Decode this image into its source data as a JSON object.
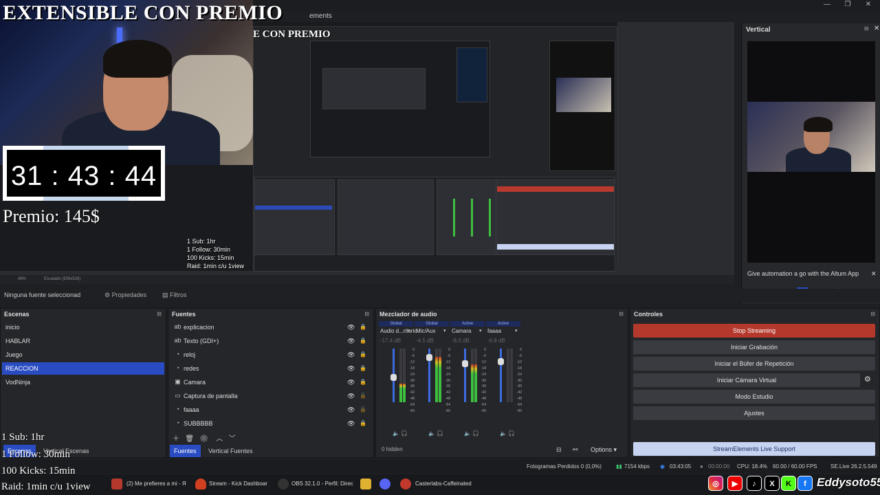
{
  "window": {
    "menu_fragment": "ements",
    "minimize": "—",
    "restore": "❐",
    "close": "✕"
  },
  "overlay": {
    "title": "EXTENSIBLE CON PREMIO",
    "title_nested": "E CON PREMIO",
    "timer": "31 : 43 : 44",
    "premio": "Premio: 145$",
    "rules": [
      "1 Sub: 1hr",
      "1 Follow: 30min",
      "100 Kicks: 15min",
      "Raid: 1min c/u 1view"
    ],
    "handle": "Eddysoto55"
  },
  "preview": {
    "zoom": "48%",
    "scale": "Escalado (939x528)"
  },
  "vertical": {
    "title": "Vertical",
    "altum_text": "Give automation a go with the Altum App"
  },
  "source_toolbar": {
    "no_source": "Ninguna fuente seleccionad",
    "properties": "Propiedades",
    "filters": "Filtros"
  },
  "scenes": {
    "title": "Escenas",
    "items": [
      "inicio",
      "HABLAR",
      "Juego",
      "REACCION",
      "VodNinja"
    ],
    "selected": "REACCION",
    "tabs": [
      "Escenas",
      "Vertical Escenas"
    ]
  },
  "sources": {
    "title": "Fuentes",
    "items": [
      {
        "icon": "ab",
        "label": "explicacion"
      },
      {
        "icon": "ab",
        "label": "Texto (GDI+)"
      },
      {
        "icon": "◔",
        "label": "reloj"
      },
      {
        "icon": "◔",
        "label": "redes"
      },
      {
        "icon": "▣",
        "label": "Camara"
      },
      {
        "icon": "▭",
        "label": "Captura de pantalla"
      },
      {
        "icon": "◔",
        "label": "faaaa"
      },
      {
        "icon": "◔",
        "label": "SUBBBBB"
      }
    ],
    "tabs": [
      "Fuentes",
      "Vertical Fuentes"
    ]
  },
  "mixer": {
    "title": "Mezclador de audio",
    "channels": [
      {
        "badge": "Global",
        "name": "Audio d...ritorio",
        "db": "-17.4 dB",
        "level": 0.35,
        "fader": 0.45
      },
      {
        "badge": "Global",
        "name": "Mic/Aux",
        "db": "-4.5 dB",
        "level": 0.85,
        "fader": 0.88
      },
      {
        "badge": "Active",
        "name": "Camara",
        "db": "-8.0 dB",
        "level": 0.7,
        "fader": 0.75
      },
      {
        "badge": "Active",
        "name": "faaaa",
        "db": "-6.8 dB",
        "level": 0.0,
        "fader": 0.8
      }
    ],
    "ticks": [
      "0",
      "-6",
      "-12",
      "-18",
      "-24",
      "-30",
      "-36",
      "-42",
      "-48",
      "-54",
      "-60"
    ],
    "hidden": "0 hidden",
    "options": "Options"
  },
  "controls": {
    "title": "Controles",
    "buttons": [
      "Stop Streaming",
      "Iniciar Grabación",
      "Iniciar el Búfer de Repetición",
      "Iniciar Cámara Virtual",
      "Modo Estudio",
      "Ajustes"
    ],
    "support": "StreamElements Live Support"
  },
  "status": {
    "dropped": "Fotogramas Perdidos 0 (0,0%)",
    "bitrate": "7154 kbps",
    "stream_time": "03:43:05",
    "rec_time": "00:00:00",
    "cpu": "CPU: 18.4%",
    "fps": "60.00 / 60.00 FPS",
    "version": "SE.Live 26.2.5.549"
  },
  "taskbar": {
    "items": [
      "(2) Me prefieres a mi - Я",
      "Stream - Kick Dashboar",
      "OBS 32.1.0 - Perfil: Direc",
      "Casterlabs-Caffeinated"
    ]
  },
  "colors": {
    "accent": "#2a4cc2",
    "stop": "#b4382c",
    "meter_green": "#3fbf3f",
    "meter_red": "#c0392b"
  }
}
